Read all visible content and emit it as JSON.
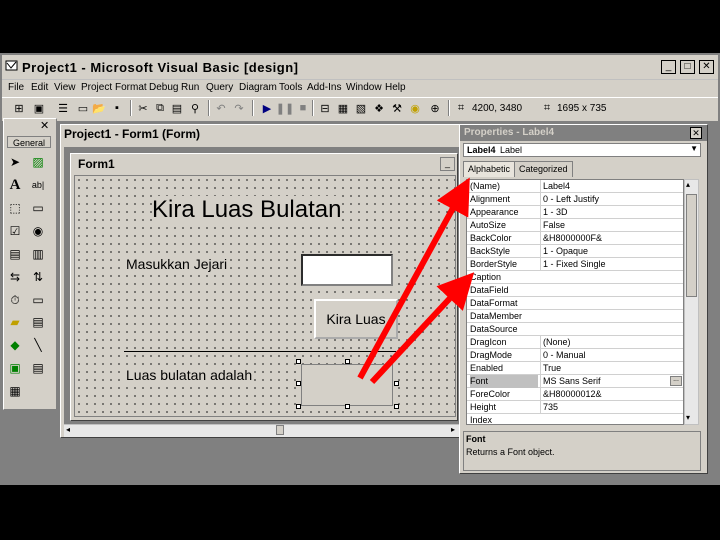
{
  "window": {
    "title": "Project1 - Microsoft Visual Basic [design]",
    "min_icon": "minimize-icon",
    "max_icon": "maximize-icon",
    "close_icon": "close-icon"
  },
  "menu": [
    "File",
    "Edit",
    "View",
    "Project",
    "Format",
    "Debug",
    "Run",
    "Query",
    "Diagram",
    "Tools",
    "Add-Ins",
    "Window",
    "Help"
  ],
  "toolbar": {
    "position": "4200, 3480",
    "size": "1695 x 735"
  },
  "toolbox": {
    "general_label": "General"
  },
  "project_window": {
    "title": "Project1 - Form1 (Form)"
  },
  "form": {
    "title": "Form1",
    "heading": "Kira Luas Bulatan",
    "input_label": "Masukkan Jejari",
    "button_label": "Kira Luas",
    "result_label": "Luas bulatan adalah"
  },
  "properties": {
    "title": "Properties - Label4",
    "object_name": "Label4",
    "object_type": "Label",
    "tabs": [
      "Alphabetic",
      "Categorized"
    ],
    "rows": [
      {
        "name": "(Name)",
        "value": "Label4"
      },
      {
        "name": "Alignment",
        "value": "0 - Left Justify"
      },
      {
        "name": "Appearance",
        "value": "1 - 3D"
      },
      {
        "name": "AutoSize",
        "value": "False"
      },
      {
        "name": "BackColor",
        "value": "&H8000000F&"
      },
      {
        "name": "BackStyle",
        "value": "1 - Opaque"
      },
      {
        "name": "BorderStyle",
        "value": "1 - Fixed Single"
      },
      {
        "name": "Caption",
        "value": ""
      },
      {
        "name": "DataField",
        "value": ""
      },
      {
        "name": "DataFormat",
        "value": ""
      },
      {
        "name": "DataMember",
        "value": ""
      },
      {
        "name": "DataSource",
        "value": ""
      },
      {
        "name": "DragIcon",
        "value": "(None)"
      },
      {
        "name": "DragMode",
        "value": "0 - Manual"
      },
      {
        "name": "Enabled",
        "value": "True"
      },
      {
        "name": "Font",
        "value": "MS Sans Serif"
      },
      {
        "name": "ForeColor",
        "value": "&H80000012&"
      },
      {
        "name": "Height",
        "value": "735"
      },
      {
        "name": "Index",
        "value": ""
      }
    ],
    "selected_row": "Font",
    "description_title": "Font",
    "description_body": "Returns a Font object."
  },
  "colors": {
    "chrome": "#d4d0c8",
    "arrow": "#ff0000"
  }
}
